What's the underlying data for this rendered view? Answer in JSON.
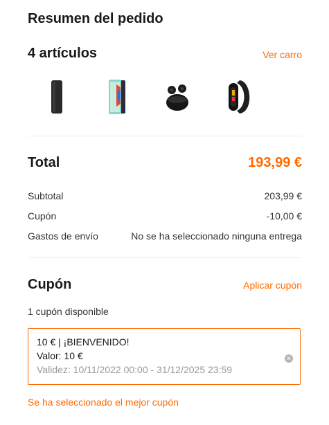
{
  "summary": {
    "title": "Resumen del pedido",
    "items_heading": "4 artículos",
    "view_cart_label": "Ver carro",
    "products": [
      {
        "icon": "power-bank-icon"
      },
      {
        "icon": "tablet-icon"
      },
      {
        "icon": "earbuds-icon"
      },
      {
        "icon": "smart-band-icon"
      }
    ]
  },
  "totals": {
    "total_label": "Total",
    "total_value": "193,99 €",
    "subtotal_label": "Subtotal",
    "subtotal_value": "203,99 €",
    "coupon_label": "Cupón",
    "coupon_value": "-10,00 €",
    "shipping_label": "Gastos de envío",
    "shipping_value": "No se ha seleccionado ninguna entrega"
  },
  "coupon": {
    "title": "Cupón",
    "apply_label": "Aplicar cupón",
    "available_text": "1 cupón disponible",
    "card": {
      "name": "10 € | ¡BIENVENIDO!",
      "value": "Valor: 10 €",
      "validity": "Validez: 10/11/2022 00:00 - 31/12/2025 23:59"
    },
    "best_selected_text": "Se ha seleccionado el mejor cupón"
  },
  "colors": {
    "accent": "#ff6a00",
    "muted": "#999999",
    "divider": "#ececec"
  }
}
